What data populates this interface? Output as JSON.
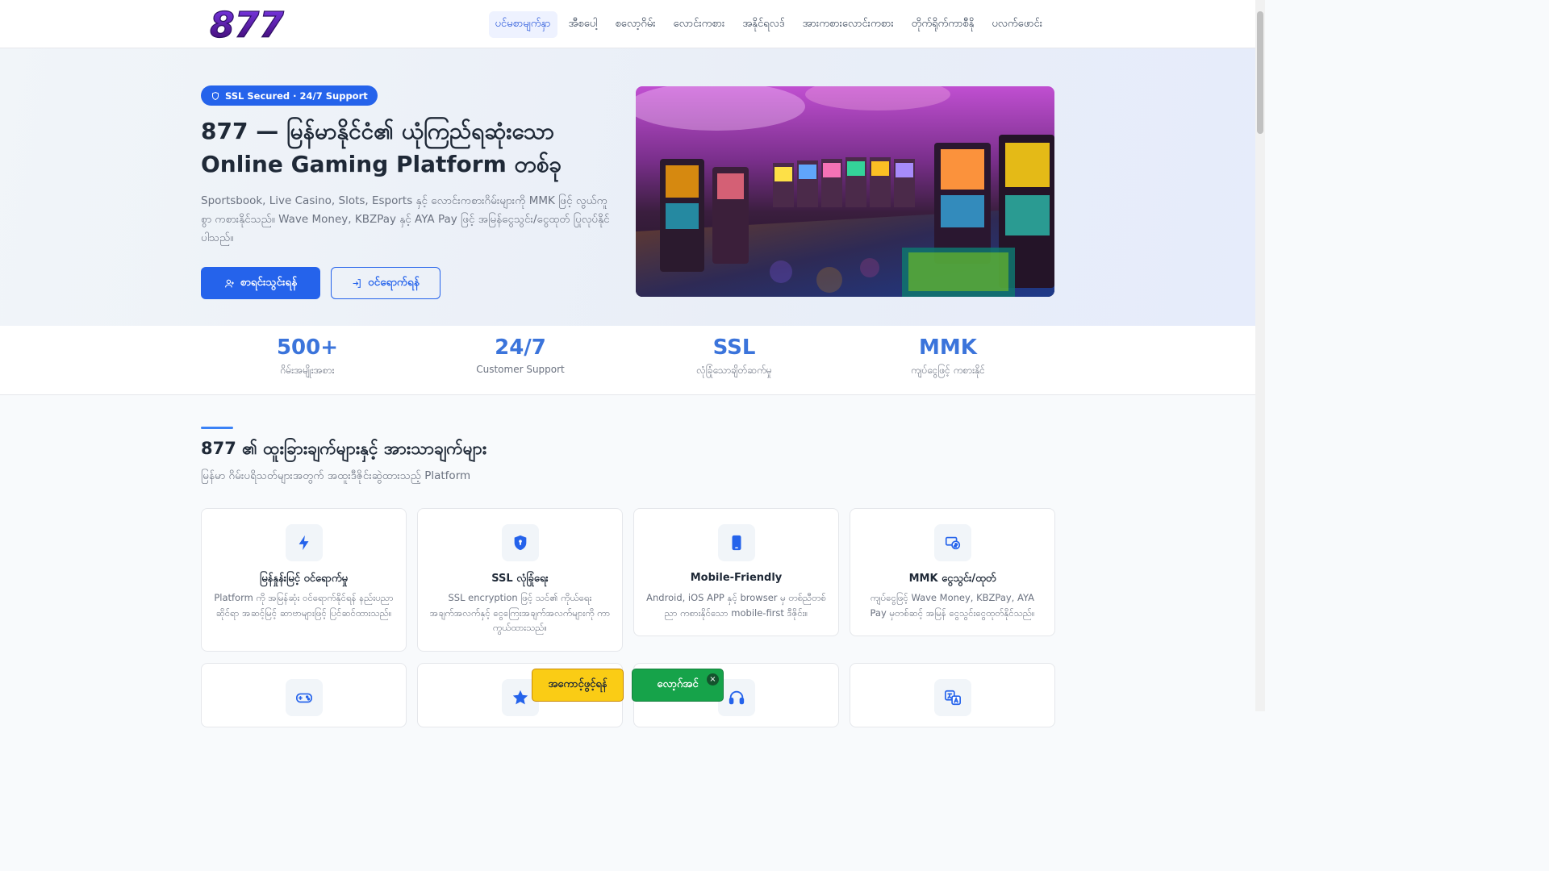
{
  "header": {
    "logo_text": "877",
    "nav": [
      {
        "label": "ပင်မစာမျက်နှာ",
        "active": true
      },
      {
        "label": "အီစပေါ့",
        "active": false
      },
      {
        "label": "စလော့ဂိမ်း",
        "active": false
      },
      {
        "label": "လောင်းကစား",
        "active": false
      },
      {
        "label": "အနိုင်ရလဒ်",
        "active": false
      },
      {
        "label": "အားကစားလောင်းကစား",
        "active": false
      },
      {
        "label": "တိုက်ရိုက်ကာစီနို",
        "active": false
      },
      {
        "label": "ပလက်ဖောင်း",
        "active": false
      }
    ]
  },
  "hero": {
    "badge": "SSL Secured · 24/7 Support",
    "badge_icon": "shield-icon",
    "title": "877 — မြန်မာနိုင်ငံ၏ ယုံကြည်ရဆုံးသော Online Gaming Platform တစ်ခု",
    "description": "Sportsbook, Live Casino, Slots, Esports နှင့် လောင်းကစားဂိမ်းများကို MMK ဖြင့် လွယ်ကူစွာ ကစားနိုင်သည်။ Wave Money, KBZPay နှင့် AYA Pay ဖြင့် အမြန်ငွေသွင်း/ငွေထုတ် ပြုလုပ်နိုင်ပါသည်။",
    "register_label": "စာရင်းသွင်းရန်",
    "register_icon": "user-plus-icon",
    "login_label": "ဝင်ရောက်ရန်",
    "login_icon": "login-icon",
    "image_subject": "casino-slot-machines-photo"
  },
  "stats": [
    {
      "value": "500+",
      "label": "ဂိမ်းအမျိုးအစား"
    },
    {
      "value": "24/7",
      "label": "Customer Support"
    },
    {
      "value": "SSL",
      "label": "လုံခြုံသောချိတ်ဆက်မှု"
    },
    {
      "value": "MMK",
      "label": "ကျပ်ငွေဖြင့် ကစားနိုင်"
    }
  ],
  "features": {
    "title": "877 ၏ ထူးခြားချက်များနှင့် အားသာချက်များ",
    "subtitle": "မြန်မာ ဂိမ်းပရိသတ်များအတွက် အထူးဒီဇိုင်းဆွဲထားသည့် Platform",
    "cards": [
      {
        "icon": "lightning-icon",
        "title": "မြန်နှုန်းမြင့် ဝင်ရောက်မှု",
        "desc": "Platform ကို အမြန်ဆုံး ဝင်ရောက်နိုင်ရန် နည်းပညာဆိုင်ရာ အဆင့်မြင့် ဆာဗာများဖြင့် ပြင်ဆင်ထားသည်။"
      },
      {
        "icon": "shield-lock-icon",
        "title": "SSL လုံခြုံရေး",
        "desc": "SSL encryption ဖြင့် သင်၏ ကိုယ်ရေးအချက်အလက်နှင့် ငွေကြေးအချက်အလက်များကို ကာကွယ်ထားသည်။"
      },
      {
        "icon": "mobile-phone-icon",
        "title": "Mobile-Friendly",
        "desc": "Android, iOS APP နှင့် browser မှ တစ်ညီတစ်ညာ ကစားနိုင်သော mobile-first ဒီဇိုင်း။"
      },
      {
        "icon": "currency-exchange-icon",
        "title": "MMK ငွေသွင်း/ထုတ်",
        "desc": "ကျပ်ငွေဖြင့် Wave Money, KBZPay, AYA Pay မှတစ်ဆင့် အမြန် ငွေသွင်းငွေထုတ်နိုင်သည်။"
      }
    ],
    "second_row_icons": [
      "gamepad-icon",
      "star-icon",
      "headset-icon",
      "translate-icon"
    ]
  },
  "floating": {
    "register_label": "အကောင့်ဖွင့်ရန်",
    "login_label": "လော့ဂ်အင်",
    "close_label": "×"
  },
  "colors": {
    "accent": "#2563eb",
    "stat": "#3b74db",
    "float_yellow": "#facc15",
    "float_green": "#16a34a"
  }
}
